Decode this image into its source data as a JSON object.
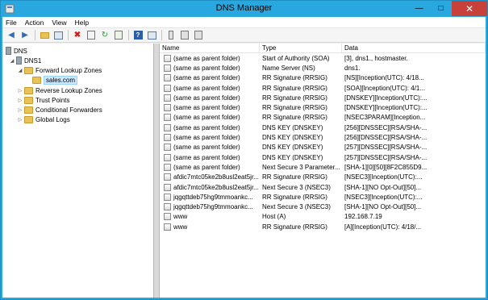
{
  "window": {
    "title": "DNS Manager"
  },
  "menu": [
    "File",
    "Action",
    "View",
    "Help"
  ],
  "toolbar_icons": [
    "back-icon",
    "forward-icon",
    "up-folder-icon",
    "show-hide-tree-icon",
    "delete-icon",
    "properties-icon",
    "refresh-icon",
    "export-icon",
    "help-icon",
    "console-icon",
    "new-host-icon",
    "new-alias-icon",
    "new-mail-exchanger-icon"
  ],
  "tree": {
    "root": "DNS",
    "server": "DNS1",
    "items": [
      "Forward Lookup Zones",
      "sales.com",
      "Reverse Lookup Zones",
      "Trust Points",
      "Conditional Forwarders",
      "Global Logs"
    ]
  },
  "columns": [
    "Name",
    "Type",
    "Data"
  ],
  "records": [
    {
      "name": "(same as parent folder)",
      "type": "Start of Authority (SOA)",
      "data": "[3], dns1., hostmaster."
    },
    {
      "name": "(same as parent folder)",
      "type": "Name Server (NS)",
      "data": "dns1."
    },
    {
      "name": "(same as parent folder)",
      "type": "RR Signature (RRSIG)",
      "data": "[NS][Inception(UTC): 4/18..."
    },
    {
      "name": "(same as parent folder)",
      "type": "RR Signature (RRSIG)",
      "data": "[SOA][Inception(UTC): 4/1..."
    },
    {
      "name": "(same as parent folder)",
      "type": "RR Signature (RRSIG)",
      "data": "[DNSKEY][Inception(UTC):..."
    },
    {
      "name": "(same as parent folder)",
      "type": "RR Signature (RRSIG)",
      "data": "[DNSKEY][Inception(UTC):..."
    },
    {
      "name": "(same as parent folder)",
      "type": "RR Signature (RRSIG)",
      "data": "[NSEC3PARAM][Inception..."
    },
    {
      "name": "(same as parent folder)",
      "type": "DNS KEY (DNSKEY)",
      "data": "[256][DNSSEC][RSA/SHA-..."
    },
    {
      "name": "(same as parent folder)",
      "type": "DNS KEY (DNSKEY)",
      "data": "[256][DNSSEC][RSA/SHA-..."
    },
    {
      "name": "(same as parent folder)",
      "type": "DNS KEY (DNSKEY)",
      "data": "[257][DNSSEC][RSA/SHA-..."
    },
    {
      "name": "(same as parent folder)",
      "type": "DNS KEY (DNSKEY)",
      "data": "[257][DNSSEC][RSA/SHA-..."
    },
    {
      "name": "(same as parent folder)",
      "type": "Next Secure 3 Parameter...",
      "data": "[SHA-1][0][50][8F2C855D9..."
    },
    {
      "name": "afdic7mtc05ke2b8usl2eat5jr...",
      "type": "RR Signature (RRSIG)",
      "data": "[NSEC3][Inception(UTC):..."
    },
    {
      "name": "afdic7mtc05ke2b8usl2eat5jr...",
      "type": "Next Secure 3 (NSEC3)",
      "data": "[SHA-1][NO Opt-Out][50]..."
    },
    {
      "name": "jqgqttdeb75hg9tmmoankc...",
      "type": "RR Signature (RRSIG)",
      "data": "[NSEC3][Inception(UTC):..."
    },
    {
      "name": "jqgqttdeb75hg9tmmoankc...",
      "type": "Next Secure 3 (NSEC3)",
      "data": "[SHA-1][NO Opt-Out][50]..."
    },
    {
      "name": "www",
      "type": "Host (A)",
      "data": "192.168.7.19"
    },
    {
      "name": "www",
      "type": "RR Signature (RRSIG)",
      "data": "[A][Inception(UTC): 4/18/..."
    }
  ],
  "colors": {
    "titlebar": "#29a8df",
    "close": "#c7413a",
    "selection": "#cce8ff"
  }
}
